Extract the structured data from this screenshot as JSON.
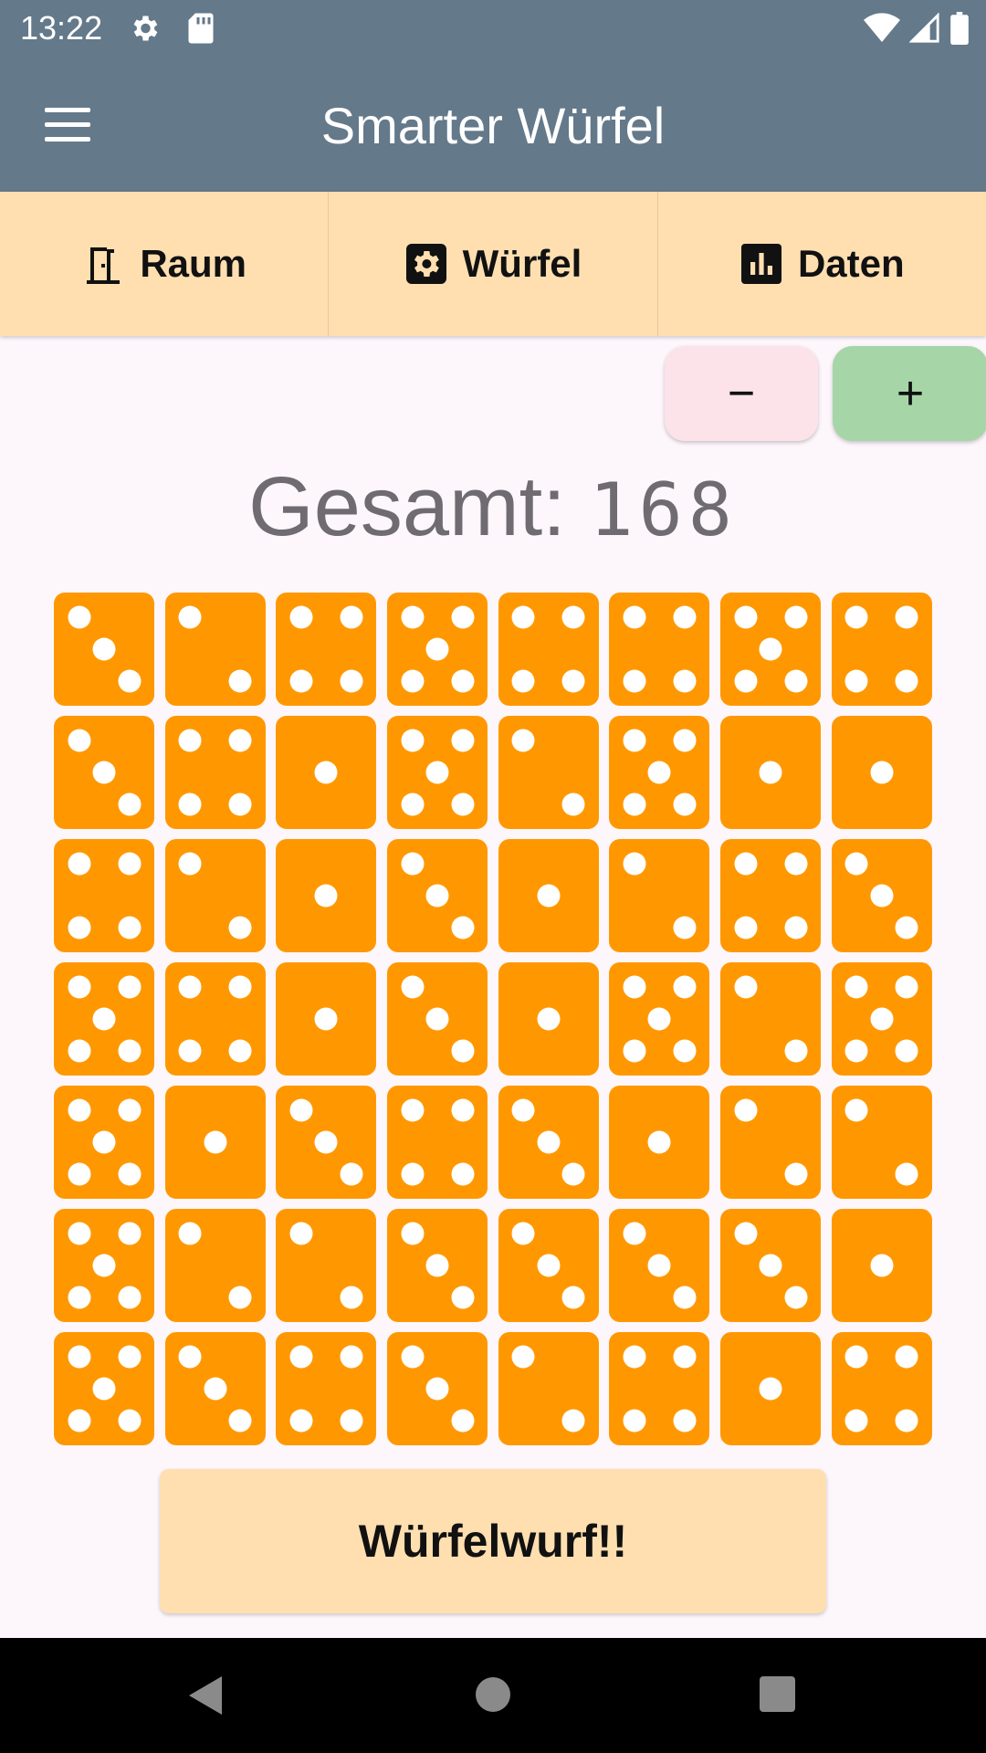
{
  "status_bar": {
    "time": "13:22",
    "icons": [
      "gear-icon",
      "sd-card-icon",
      "wifi-icon",
      "signal-icon",
      "battery-icon"
    ]
  },
  "app_bar": {
    "title": "Smarter Würfel",
    "menu_icon": "menu-icon"
  },
  "tabs": [
    {
      "label": "Raum",
      "icon": "door-icon"
    },
    {
      "label": "Würfel",
      "icon": "dice-settings-icon"
    },
    {
      "label": "Daten",
      "icon": "bar-chart-icon"
    }
  ],
  "stepper": {
    "minus_label": "−",
    "plus_label": "+"
  },
  "total": {
    "label": "Gesamt:",
    "value": "168"
  },
  "dice": [
    3,
    2,
    4,
    5,
    4,
    4,
    5,
    4,
    3,
    4,
    1,
    5,
    2,
    5,
    1,
    1,
    4,
    2,
    1,
    3,
    1,
    2,
    4,
    3,
    5,
    4,
    1,
    3,
    1,
    5,
    2,
    5,
    5,
    1,
    3,
    4,
    3,
    1,
    2,
    2,
    5,
    2,
    2,
    3,
    3,
    3,
    3,
    1,
    5,
    3,
    4,
    3,
    2,
    4,
    1,
    4
  ],
  "roll_button": {
    "label": "Würfelwurf!!"
  },
  "colors": {
    "app_bar": "#64798A",
    "tab_bar": "#FFDFB0",
    "die": "#FF9800",
    "minus_button": "#FBE3E9",
    "plus_button": "#A6D6A7",
    "background": "#FDF7FC"
  }
}
